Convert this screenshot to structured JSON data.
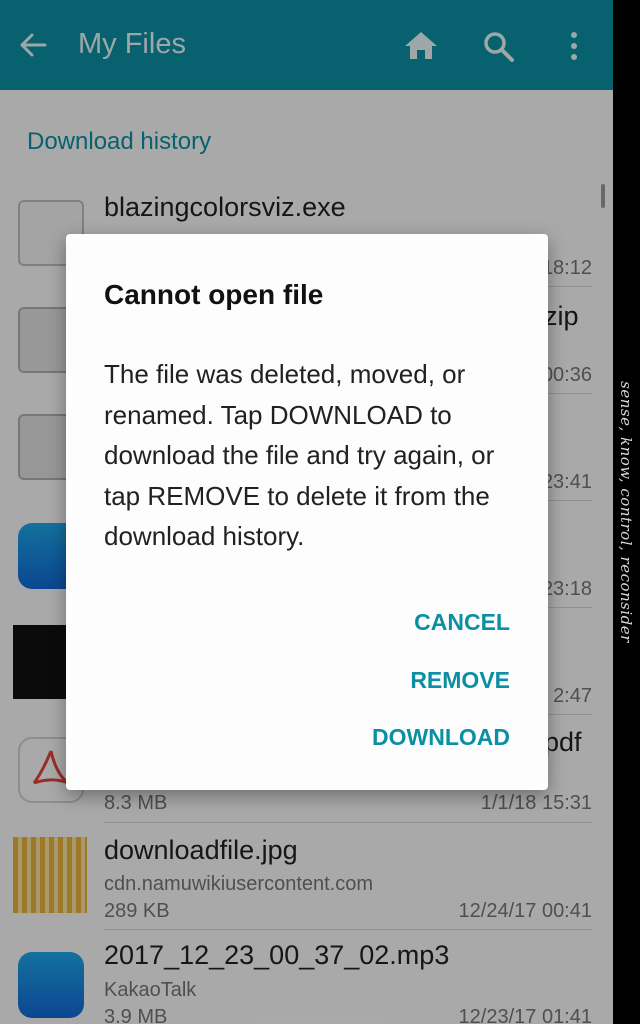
{
  "app_bar": {
    "title": "My Files",
    "back_icon": "arrow-left-icon",
    "home_icon": "home-icon",
    "search_icon": "search-icon",
    "more_icon": "more-vert-icon",
    "color": "#0b8fa3"
  },
  "section": {
    "header": "Download history"
  },
  "rows": [
    {
      "name": "blazingcolorsviz.exe",
      "sub": "",
      "size": "",
      "date": "18:12",
      "icon": "file-icon"
    },
    {
      "name": "zip",
      "sub": "",
      "size": "",
      "date": "00:36",
      "icon": "zip-icon"
    },
    {
      "name": "",
      "sub": "",
      "size": "",
      "date": "23:41",
      "icon": "zip-icon"
    },
    {
      "name": "",
      "sub": "",
      "size": "",
      "date": "23:18",
      "icon": "music-icon"
    },
    {
      "name": "",
      "sub": "",
      "size": "",
      "date": "2:47",
      "icon": "image-thumbnail"
    },
    {
      "name": "pdf",
      "sub": "",
      "size": "8.3 MB",
      "date": "1/1/18 15:31",
      "icon": "pdf-icon"
    },
    {
      "name": "downloadfile.jpg",
      "sub": "cdn.namuwikiusercontent.com",
      "size": "289 KB",
      "date": "12/24/17 00:41",
      "icon": "image-thumbnail"
    },
    {
      "name": "2017_12_23_00_37_02.mp3",
      "sub": "KakaoTalk",
      "size": "3.9 MB",
      "date": "12/23/17 01:41",
      "icon": "music-icon"
    }
  ],
  "dialog": {
    "title": "Cannot open file",
    "message": "The file was deleted, moved, or renamed. Tap DOWNLOAD to download the file and try again, or tap REMOVE to delete it from the download history.",
    "buttons": {
      "cancel": "CANCEL",
      "remove": "REMOVE",
      "download": "DOWNLOAD"
    }
  },
  "edge_caption": "sense, know, control, reconsider"
}
